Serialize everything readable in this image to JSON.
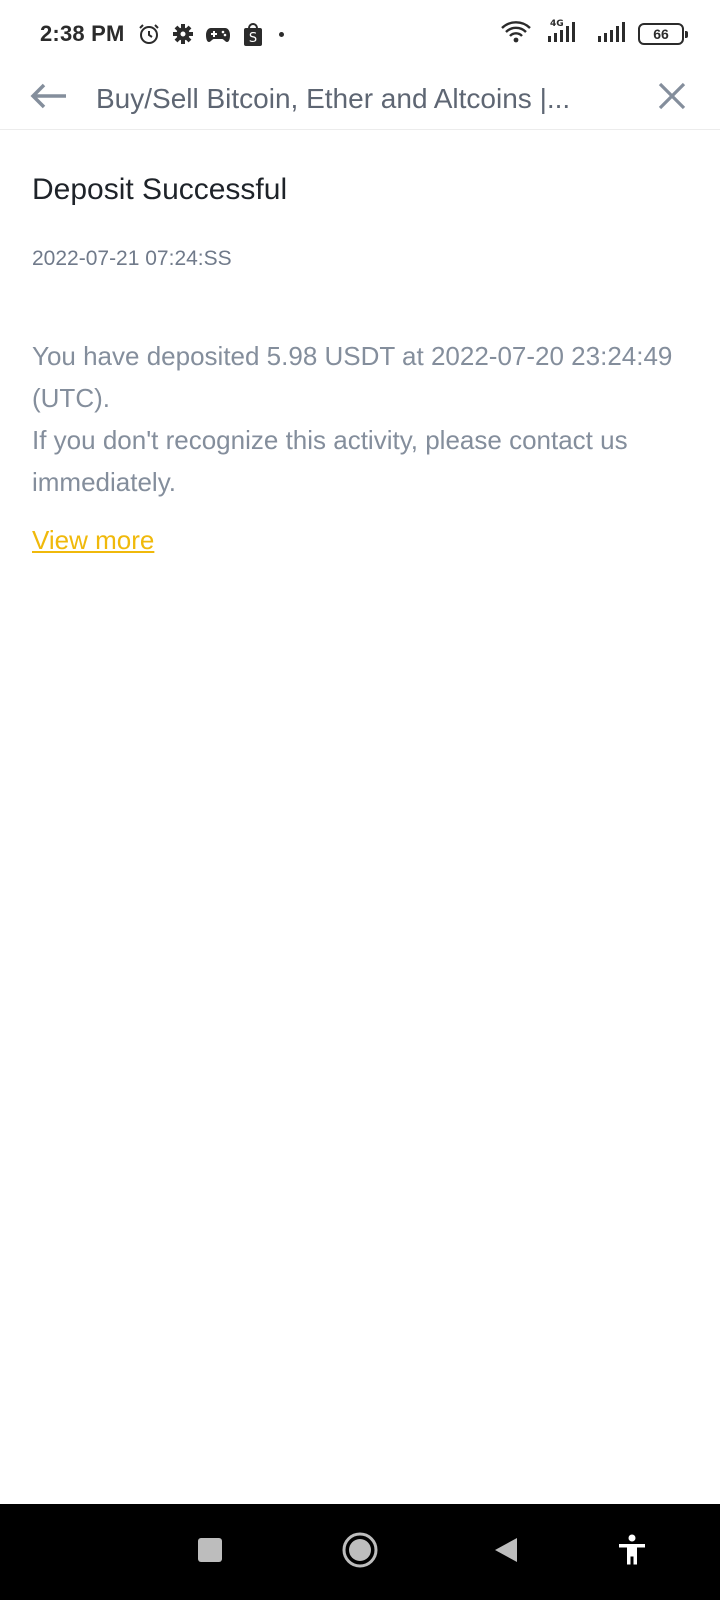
{
  "status_bar": {
    "time": "2:38 PM",
    "left_icons": [
      "alarm-icon",
      "settings-icon",
      "game-controller-icon",
      "shop-bag-icon"
    ],
    "network_label": "4G",
    "battery_level": "66"
  },
  "toolbar": {
    "title": "Buy/Sell Bitcoin, Ether and Altcoins |..."
  },
  "message": {
    "title": "Deposit Successful",
    "date": "2022-07-21 07:24:SS",
    "body_line1": "You have deposited 5.98 USDT at 2022-07-20 23:24:49 (UTC).",
    "body_line2": "If you don't recognize this activity, please contact us immediately.",
    "link_label": "View more"
  },
  "colors": {
    "accent": "#f0b90b",
    "title": "#1e2329",
    "body": "#848e9c"
  },
  "nav": [
    "recents-square-icon",
    "home-circle-icon",
    "back-triangle-icon",
    "accessibility-icon"
  ]
}
